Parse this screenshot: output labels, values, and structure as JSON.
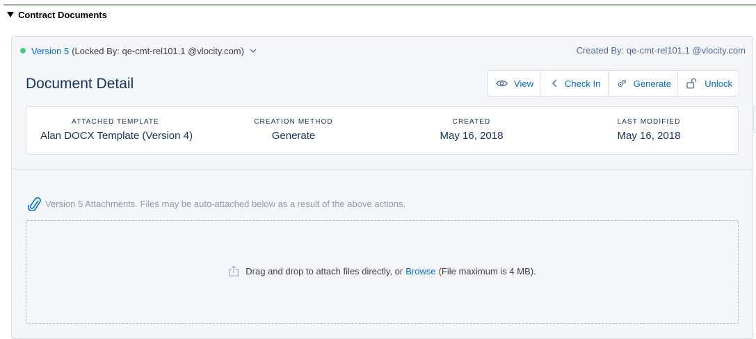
{
  "section": {
    "title": "Contract Documents"
  },
  "version": {
    "link": "Version 5",
    "locked_by": "(Locked By: qe-cmt-rel101.1 @vlocity.com)",
    "status_color": "#4bca81"
  },
  "created_by": "Created By: qe-cmt-rel101.1 @vlocity.com",
  "detail": {
    "title": "Document Detail",
    "fields": [
      {
        "label": "Attached Template",
        "value": "Alan DOCX Template (Version 4)"
      },
      {
        "label": "Creation Method",
        "value": "Generate"
      },
      {
        "label": "Created",
        "value": "May 16, 2018"
      },
      {
        "label": "Last Modified",
        "value": "May 16, 2018"
      }
    ]
  },
  "actions": {
    "view": "View",
    "check_in": "Check In",
    "generate": "Generate",
    "unlock": "Unlock"
  },
  "attachments": {
    "caption": "Version 5 Attachments. Files may be auto-attached below as a result of the above actions.",
    "drop_prefix": "Drag and drop to attach files directly, or",
    "browse": "Browse",
    "drop_suffix": "(File maximum is 4 MB)."
  },
  "icons": {
    "collapse": "triangle-down-icon",
    "version_menu": "chevron-down-icon",
    "view": "eye-icon",
    "check_in": "chevron-left-icon",
    "generate": "gears-icon",
    "unlock": "unlock-icon",
    "attachments": "paperclip-icon",
    "upload": "upload-icon"
  },
  "colors": {
    "link": "#0070d2",
    "text": "#16325c",
    "muted": "#8e9aa8"
  }
}
